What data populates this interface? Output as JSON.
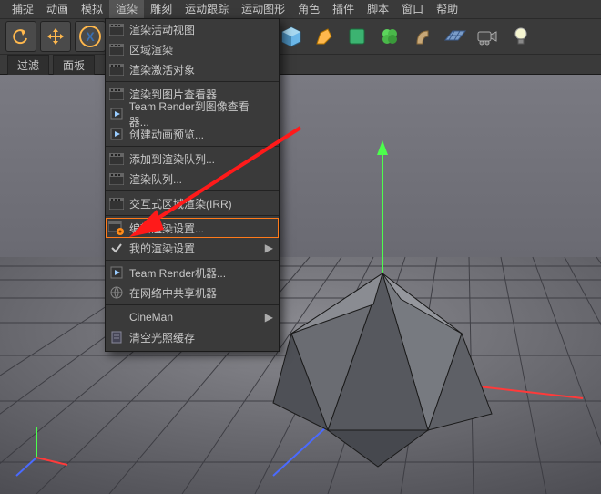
{
  "menubar": {
    "items": [
      "捕捉",
      "动画",
      "模拟",
      "渲染",
      "雕刻",
      "运动跟踪",
      "运动图形",
      "角色",
      "插件",
      "脚本",
      "窗口",
      "帮助"
    ],
    "open_index": 3
  },
  "toolbar": {
    "icons": [
      "undo",
      "move",
      "x",
      "clapper1",
      "clapper2",
      "clapper-gear",
      "gear",
      "cube",
      "sphere",
      "box",
      "clover",
      "tube",
      "grid",
      "camera",
      "light"
    ]
  },
  "tabs": {
    "left": "过滤",
    "right": "面板"
  },
  "dropdown": {
    "groups": [
      [
        {
          "icon": "clapper",
          "label": "渲染活动视图"
        },
        {
          "icon": "clapper",
          "label": "区域渲染"
        },
        {
          "icon": "clapper",
          "label": "渲染激活对象"
        }
      ],
      [
        {
          "icon": "clapper",
          "label": "渲染到图片查看器"
        },
        {
          "icon": "play",
          "label": "Team Render到图像查看器..."
        },
        {
          "icon": "play",
          "label": "创建动画预览..."
        }
      ],
      [
        {
          "icon": "clapper",
          "label": "添加到渲染队列..."
        },
        {
          "icon": "clapper",
          "label": "渲染队列..."
        }
      ],
      [
        {
          "icon": "clapper",
          "label": "交互式区域渲染(IRR)"
        }
      ],
      [
        {
          "icon": "clapper-gear",
          "label": "编辑渲染设置...",
          "selected": true
        },
        {
          "icon": "check",
          "label": "我的渲染设置",
          "submenu": true
        }
      ],
      [
        {
          "icon": "play",
          "label": "Team Render机器..."
        },
        {
          "icon": "net",
          "label": "在网络中共享机器"
        }
      ],
      [
        {
          "icon": "none",
          "label": "CineMan",
          "submenu": true
        },
        {
          "icon": "doc",
          "label": "清空光照缓存"
        }
      ]
    ]
  }
}
